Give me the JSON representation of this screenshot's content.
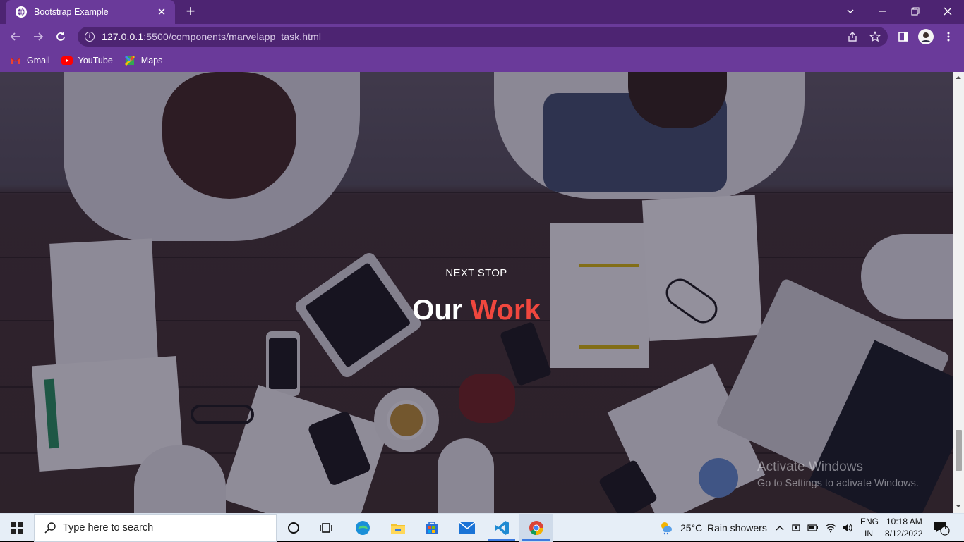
{
  "browser": {
    "tab_title": "Bootstrap Example",
    "url_host": "127.0.0.1",
    "url_rest": ":5500/components/marvelapp_task.html",
    "bookmarks": [
      {
        "label": "Gmail",
        "icon": "gmail-icon"
      },
      {
        "label": "YouTube",
        "icon": "youtube-icon"
      },
      {
        "label": "Maps",
        "icon": "maps-icon"
      }
    ]
  },
  "hero": {
    "kicker": "NEXT STOP",
    "title_white": "Our",
    "title_accent": "Work",
    "accent_color": "#f0473e"
  },
  "watermark": {
    "line1": "Activate Windows",
    "line2": "Go to Settings to activate Windows."
  },
  "taskbar": {
    "search_placeholder": "Type here to search",
    "weather_temp": "25°C",
    "weather_text": "Rain showers",
    "lang_line1": "ENG",
    "lang_line2": "IN",
    "time": "10:18 AM",
    "date": "8/12/2022",
    "notification_count": "1"
  },
  "colors": {
    "titlebar": "#4d2472",
    "toolbar": "#6a3a9a"
  }
}
